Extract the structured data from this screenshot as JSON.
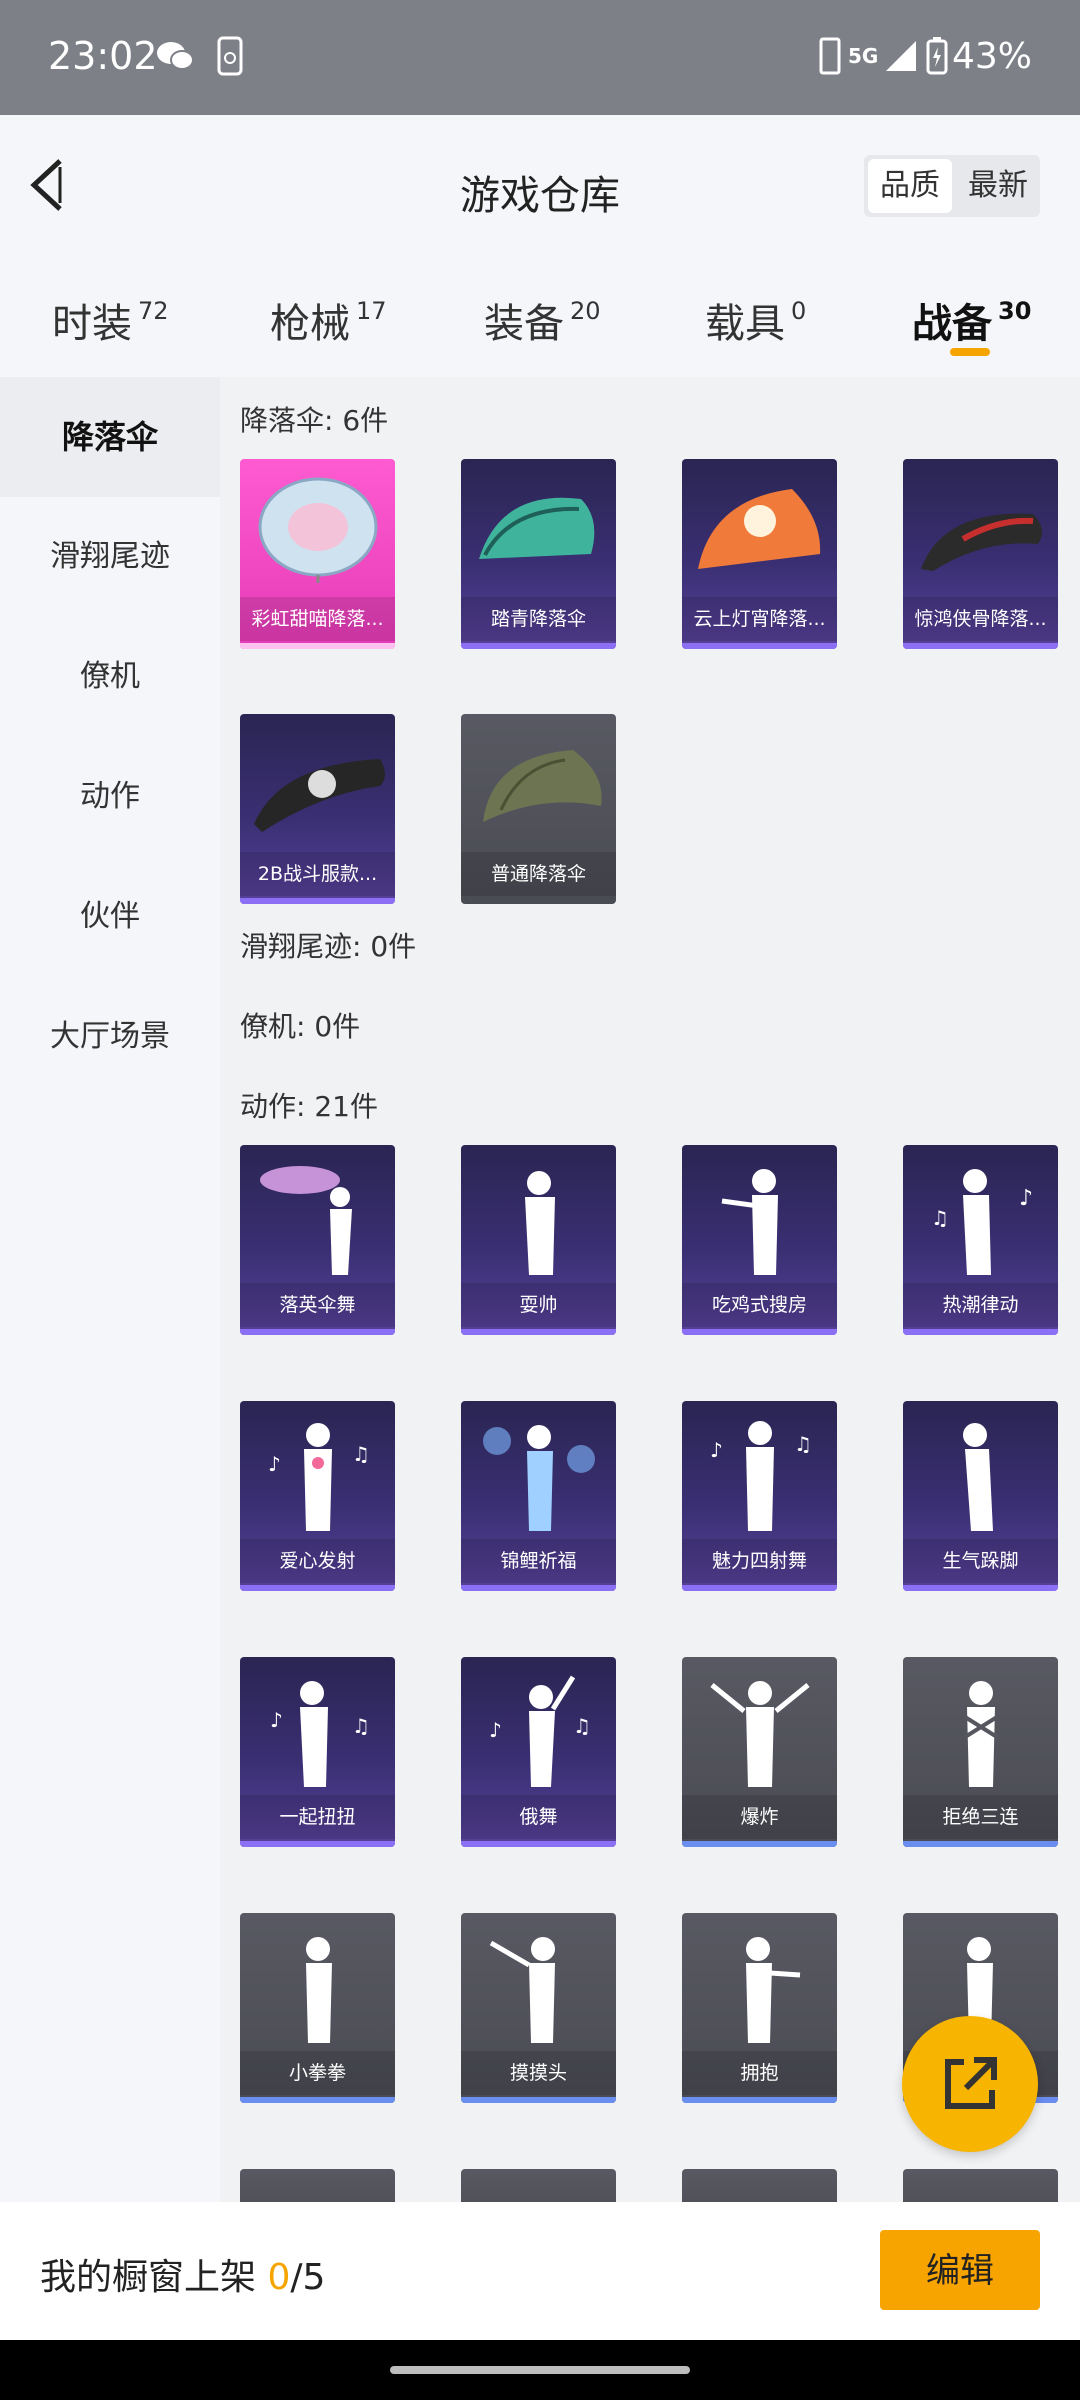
{
  "status": {
    "time": "23:02",
    "network": "5G",
    "battery": "43%"
  },
  "header": {
    "title": "游戏仓库",
    "sort_quality": "品质",
    "sort_latest": "最新"
  },
  "tabs": [
    {
      "label": "时装",
      "count": "72"
    },
    {
      "label": "枪械",
      "count": "17"
    },
    {
      "label": "装备",
      "count": "20"
    },
    {
      "label": "载具",
      "count": "0"
    },
    {
      "label": "战备",
      "count": "30"
    }
  ],
  "sidebar": [
    "降落伞",
    "滑翔尾迹",
    "僚机",
    "动作",
    "伙伴",
    "大厅场景"
  ],
  "sections": {
    "parachute": "降落伞: 6件",
    "trail": "滑翔尾迹: 0件",
    "wingman": "僚机: 0件",
    "emote": "动作: 21件"
  },
  "parachutes": [
    "彩虹甜喵降落...",
    "踏青降落伞",
    "云上灯宵降落...",
    "惊鸿侠骨降落...",
    "2B战斗服款...",
    "普通降落伞"
  ],
  "emotes": [
    "落英伞舞",
    "耍帅",
    "吃鸡式搜房",
    "热潮律动",
    "爱心发射",
    "锦鲤祈福",
    "魅力四射舞",
    "生气跺脚",
    "一起扭扭",
    "俄舞",
    "爆炸",
    "拒绝三连",
    "小拳拳",
    "摸摸头",
    "拥抱",
    ""
  ],
  "footer": {
    "prefix": "我的橱窗上架 ",
    "count": "0",
    "total": "/5",
    "edit": "编辑"
  },
  "colors": {
    "accent": "#f5a400",
    "card_purple": "#3a2f73",
    "card_pink": "#e43bb6",
    "card_grey": "#4a4b53"
  }
}
